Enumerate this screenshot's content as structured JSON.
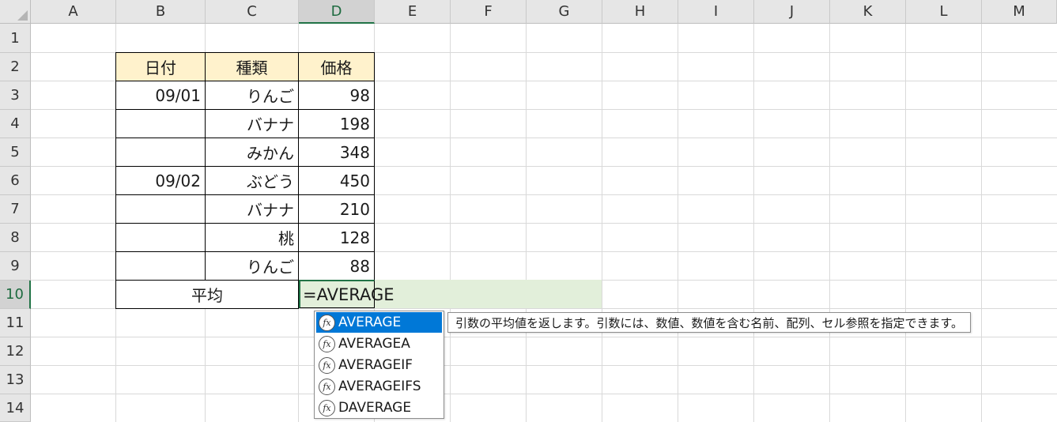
{
  "columns": [
    "A",
    "B",
    "C",
    "D",
    "E",
    "F",
    "G",
    "H",
    "I",
    "J",
    "K",
    "L",
    "M"
  ],
  "rows": [
    "1",
    "2",
    "3",
    "4",
    "5",
    "6",
    "7",
    "8",
    "9",
    "10",
    "11",
    "12",
    "13",
    "14"
  ],
  "active_cell": {
    "column": "D",
    "row": "10"
  },
  "table": {
    "headers": [
      "日付",
      "種類",
      "価格"
    ],
    "rows": [
      {
        "date": "09/01",
        "kind": "りんご",
        "price": "98"
      },
      {
        "date": "",
        "kind": "バナナ",
        "price": "198"
      },
      {
        "date": "",
        "kind": "みかん",
        "price": "348"
      },
      {
        "date": "09/02",
        "kind": "ぶどう",
        "price": "450"
      },
      {
        "date": "",
        "kind": "バナナ",
        "price": "210"
      },
      {
        "date": "",
        "kind": "桃",
        "price": "128"
      },
      {
        "date": "",
        "kind": "りんご",
        "price": "88"
      }
    ],
    "average_label": "平均",
    "formula_input": "=AVERAGE"
  },
  "autocomplete": {
    "icon": "fx-icon",
    "icon_glyph": "fx",
    "items": [
      "AVERAGE",
      "AVERAGEA",
      "AVERAGEIF",
      "AVERAGEIFS",
      "DAVERAGE"
    ],
    "selected_index": 0,
    "tooltip": "引数の平均値を返します。引数には、数値、数値を含む名前、配列、セル参照を指定できます。"
  },
  "colors": {
    "header_fill": "#fff2cc",
    "edit_fill": "#e2efda",
    "selection_accent": "#217346",
    "dropdown_selected": "#0078d7"
  }
}
